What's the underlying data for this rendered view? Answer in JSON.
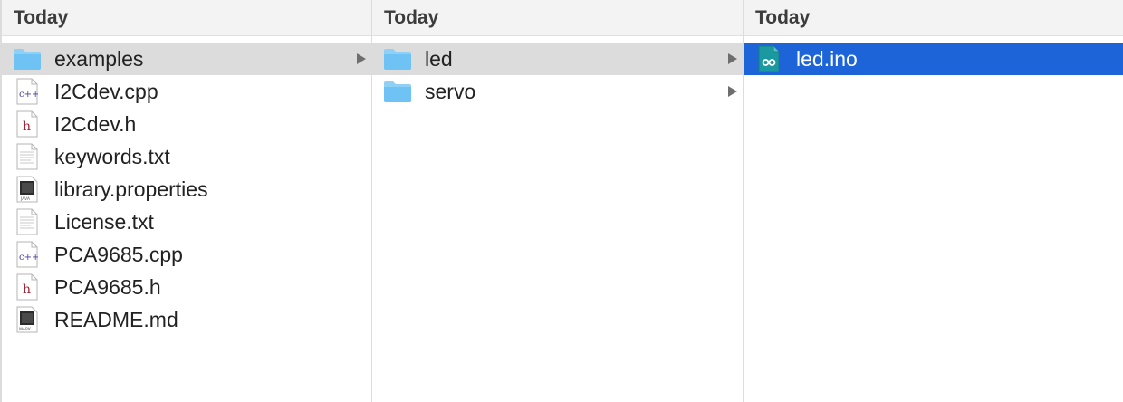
{
  "columns": [
    {
      "header": "Today",
      "items": [
        {
          "label": "examples",
          "icon": "folder-icon"
        },
        {
          "label": "I2Cdev.cpp",
          "icon": "cpp-file-icon",
          "badge": "c++"
        },
        {
          "label": "I2Cdev.h",
          "icon": "header-file-icon",
          "badge": "h"
        },
        {
          "label": "keywords.txt",
          "icon": "text-file-icon"
        },
        {
          "label": "library.properties",
          "icon": "java-file-icon",
          "badge": "JAVA"
        },
        {
          "label": "License.txt",
          "icon": "text-file-icon"
        },
        {
          "label": "PCA9685.cpp",
          "icon": "cpp-file-icon",
          "badge": "c++"
        },
        {
          "label": "PCA9685.h",
          "icon": "header-file-icon",
          "badge": "h"
        },
        {
          "label": "README.md",
          "icon": "markdown-file-icon",
          "badge": "MARK..."
        }
      ]
    },
    {
      "header": "Today",
      "items": [
        {
          "label": "led",
          "icon": "folder-icon"
        },
        {
          "label": "servo",
          "icon": "folder-icon"
        }
      ]
    },
    {
      "header": "Today",
      "items": [
        {
          "label": "led.ino",
          "icon": "arduino-file-icon"
        }
      ]
    }
  ],
  "colors": {
    "folder": "#6ec3f4",
    "selection_blue": "#1c64d8",
    "selection_gray": "#dcdcdc",
    "arduino_teal": "#1a9aa0"
  }
}
